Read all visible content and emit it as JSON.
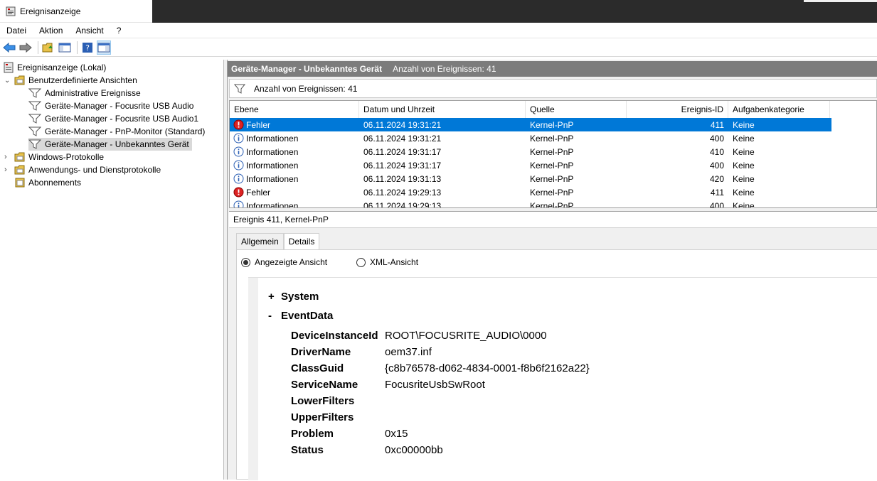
{
  "window": {
    "title": "Ereignisanzeige"
  },
  "menu": [
    "Datei",
    "Aktion",
    "Ansicht",
    "?"
  ],
  "toolbar": [
    "back-icon",
    "forward-icon",
    "open-folder-icon",
    "console-tree-icon",
    "help-icon",
    "action-pane-icon"
  ],
  "tree": {
    "root": "Ereignisanzeige (Lokal)",
    "custom_views": "Benutzerdefinierte Ansichten",
    "custom_items": [
      "Administrative Ereignisse",
      "Geräte-Manager - Focusrite USB Audio",
      "Geräte-Manager - Focusrite USB Audio1",
      "Geräte-Manager - PnP-Monitor (Standard)",
      "Geräte-Manager - Unbekanntes Gerät"
    ],
    "windows_logs": "Windows-Protokolle",
    "app_logs": "Anwendungs- und Dienstprotokolle",
    "subscriptions": "Abonnements"
  },
  "pane": {
    "title": "Geräte-Manager - Unbekanntes Gerät",
    "count": "Anzahl von Ereignissen: 41",
    "filter": "Anzahl von Ereignissen: 41"
  },
  "columns": [
    "Ebene",
    "Datum und Uhrzeit",
    "Quelle",
    "Ereignis-ID",
    "Aufgabenkategorie"
  ],
  "rows": [
    {
      "level": "Fehler",
      "icon": "error-icon",
      "date": "06.11.2024 19:31:21",
      "source": "Kernel-PnP",
      "id": "411",
      "cat": "Keine"
    },
    {
      "level": "Informationen",
      "icon": "info-icon",
      "date": "06.11.2024 19:31:21",
      "source": "Kernel-PnP",
      "id": "400",
      "cat": "Keine"
    },
    {
      "level": "Informationen",
      "icon": "info-icon",
      "date": "06.11.2024 19:31:17",
      "source": "Kernel-PnP",
      "id": "410",
      "cat": "Keine"
    },
    {
      "level": "Informationen",
      "icon": "info-icon",
      "date": "06.11.2024 19:31:17",
      "source": "Kernel-PnP",
      "id": "400",
      "cat": "Keine"
    },
    {
      "level": "Informationen",
      "icon": "info-icon",
      "date": "06.11.2024 19:31:13",
      "source": "Kernel-PnP",
      "id": "420",
      "cat": "Keine"
    },
    {
      "level": "Fehler",
      "icon": "error-icon",
      "date": "06.11.2024 19:29:13",
      "source": "Kernel-PnP",
      "id": "411",
      "cat": "Keine"
    },
    {
      "level": "Informationen",
      "icon": "info-icon",
      "date": "06.11.2024 19:29:13",
      "source": "Kernel-PnP",
      "id": "400",
      "cat": "Keine"
    }
  ],
  "detail": {
    "header": "Ereignis 411, Kernel-PnP",
    "tabs": [
      "Allgemein",
      "Details"
    ],
    "radio_friendly": "Angezeigte Ansicht",
    "radio_xml": "XML-Ansicht",
    "system": "System",
    "system_toggle": "+",
    "eventdata": "EventData",
    "eventdata_toggle": "-",
    "fields": [
      {
        "k": "DeviceInstanceId",
        "v": "ROOT\\FOCUSRITE_AUDIO\\0000"
      },
      {
        "k": "DriverName",
        "v": "oem37.inf"
      },
      {
        "k": "ClassGuid",
        "v": "{c8b76578-d062-4834-0001-f8b6f2162a22}"
      },
      {
        "k": "ServiceName",
        "v": "FocusriteUsbSwRoot"
      },
      {
        "k": "LowerFilters",
        "v": ""
      },
      {
        "k": "UpperFilters",
        "v": ""
      },
      {
        "k": "Problem",
        "v": "0x15"
      },
      {
        "k": "Status",
        "v": "0xc00000bb"
      }
    ]
  }
}
